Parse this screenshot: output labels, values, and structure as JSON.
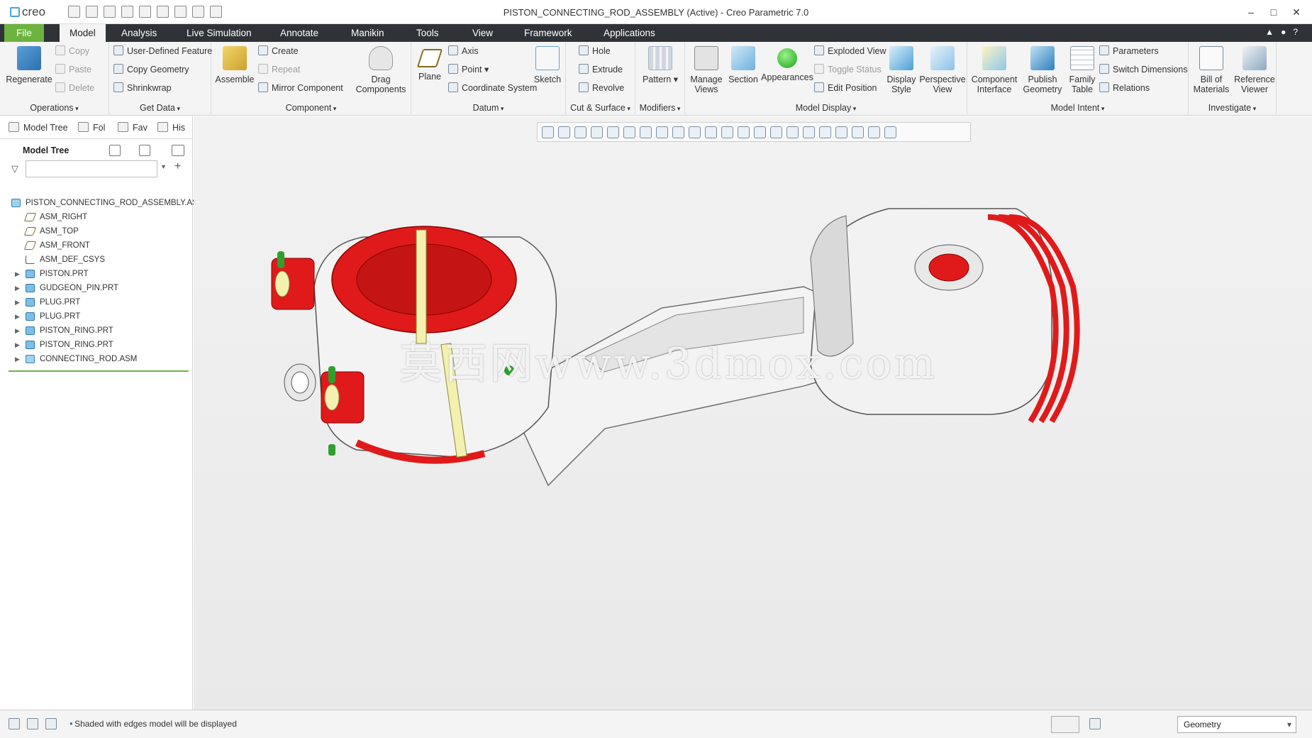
{
  "app": {
    "logo": "creo",
    "window_title": "PISTON_CONNECTING_ROD_ASSEMBLY (Active) - Creo Parametric 7.0"
  },
  "tabs": [
    {
      "label": "File"
    },
    {
      "label": "Model"
    },
    {
      "label": "Analysis"
    },
    {
      "label": "Live Simulation"
    },
    {
      "label": "Annotate"
    },
    {
      "label": "Manikin"
    },
    {
      "label": "Tools"
    },
    {
      "label": "View"
    },
    {
      "label": "Framework"
    },
    {
      "label": "Applications"
    }
  ],
  "ribbon": {
    "operations": {
      "title": "Operations",
      "regenerate": "Regenerate",
      "copy": "Copy",
      "paste": "Paste",
      "delete": "Delete"
    },
    "get_data": {
      "title": "Get Data",
      "udf": "User-Defined Feature",
      "copy_geometry": "Copy Geometry",
      "shrinkwrap": "Shrinkwrap"
    },
    "component": {
      "title": "Component",
      "assemble": "Assemble",
      "create": "Create",
      "repeat": "Repeat",
      "mirror": "Mirror Component",
      "drag": "Drag Components"
    },
    "datum": {
      "title": "Datum",
      "plane": "Plane",
      "axis": "Axis",
      "point": "Point",
      "csys": "Coordinate System",
      "sketch": "Sketch"
    },
    "cut_surface": {
      "title": "Cut & Surface",
      "hole": "Hole",
      "extrude": "Extrude",
      "revolve": "Revolve"
    },
    "modifiers": {
      "title": "Modifiers",
      "pattern": "Pattern"
    },
    "model_display": {
      "title": "Model Display",
      "manage_views": "Manage Views",
      "section": "Section",
      "appearances": "Appearances",
      "exploded": "Exploded View",
      "toggle": "Toggle Status",
      "edit_pos": "Edit Position",
      "display_style": "Display Style",
      "perspective": "Perspective View"
    },
    "model_intent": {
      "title": "Model Intent",
      "comp_interface": "Component Interface",
      "publish": "Publish Geometry",
      "family": "Family Table",
      "parameters": "Parameters",
      "switch_dims": "Switch Dimensions",
      "relations": "Relations"
    },
    "investigate": {
      "title": "Investigate",
      "bom": "Bill of Materials",
      "ref_viewer": "Reference Viewer"
    }
  },
  "left_panel": {
    "tabs": [
      {
        "label": "Model Tree"
      },
      {
        "label": "Fol"
      },
      {
        "label": "Fav"
      },
      {
        "label": "His"
      }
    ],
    "tree_title": "Model Tree",
    "filter_placeholder": "",
    "nodes": [
      {
        "label": "PISTON_CONNECTING_ROD_ASSEMBLY.ASM",
        "icon": "assembly-icon",
        "expandable": false
      },
      {
        "label": "ASM_RIGHT",
        "icon": "datum-plane-icon",
        "expandable": false
      },
      {
        "label": "ASM_TOP",
        "icon": "datum-plane-icon",
        "expandable": false
      },
      {
        "label": "ASM_FRONT",
        "icon": "datum-plane-icon",
        "expandable": false
      },
      {
        "label": "ASM_DEF_CSYS",
        "icon": "csys-icon",
        "expandable": false
      },
      {
        "label": "PISTON.PRT",
        "icon": "part-icon",
        "expandable": true
      },
      {
        "label": "GUDGEON_PIN.PRT",
        "icon": "part-icon",
        "expandable": true
      },
      {
        "label": "PLUG.PRT",
        "icon": "part-icon",
        "expandable": true
      },
      {
        "label": "PLUG.PRT",
        "icon": "part-icon",
        "expandable": true
      },
      {
        "label": "PISTON_RING.PRT",
        "icon": "part-icon",
        "expandable": true
      },
      {
        "label": "PISTON_RING.PRT",
        "icon": "part-icon",
        "expandable": true
      },
      {
        "label": "CONNECTING_ROD.ASM",
        "icon": "assembly-icon",
        "expandable": true
      }
    ]
  },
  "graphics": {
    "watermark": "莫西网www.3dmox.com"
  },
  "statusbar": {
    "message": "Shaded with edges model will be displayed",
    "selection_filter": "Geometry"
  },
  "colors": {
    "accent_green": "#6cb33f",
    "tabbar": "#2f3337",
    "model_red": "#e01a1a",
    "model_white": "#f4f4f4",
    "model_yellow": "#f3f0b0"
  }
}
